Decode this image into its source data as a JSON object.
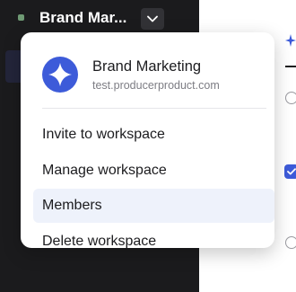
{
  "sidebar": {
    "workspace_name": "Brand Mar..."
  },
  "menu": {
    "title": "Brand Marketing",
    "domain": "test.producerproduct.com",
    "items": [
      {
        "label": "Invite to workspace"
      },
      {
        "label": "Manage workspace"
      },
      {
        "label": "Members",
        "active": true
      },
      {
        "label": "Delete workspace"
      }
    ]
  },
  "icons": {
    "workspace_status": "status-dot",
    "toggle": "chevron-down-icon",
    "logo": "workspace-logo-icon",
    "sparkle": "sparkle-icon",
    "checkbox": "checkbox-checked-icon"
  },
  "colors": {
    "accent": "#3d5bd9",
    "sidebar_bg": "#1b1b1d",
    "active_item_bg": "#eef2fb"
  }
}
